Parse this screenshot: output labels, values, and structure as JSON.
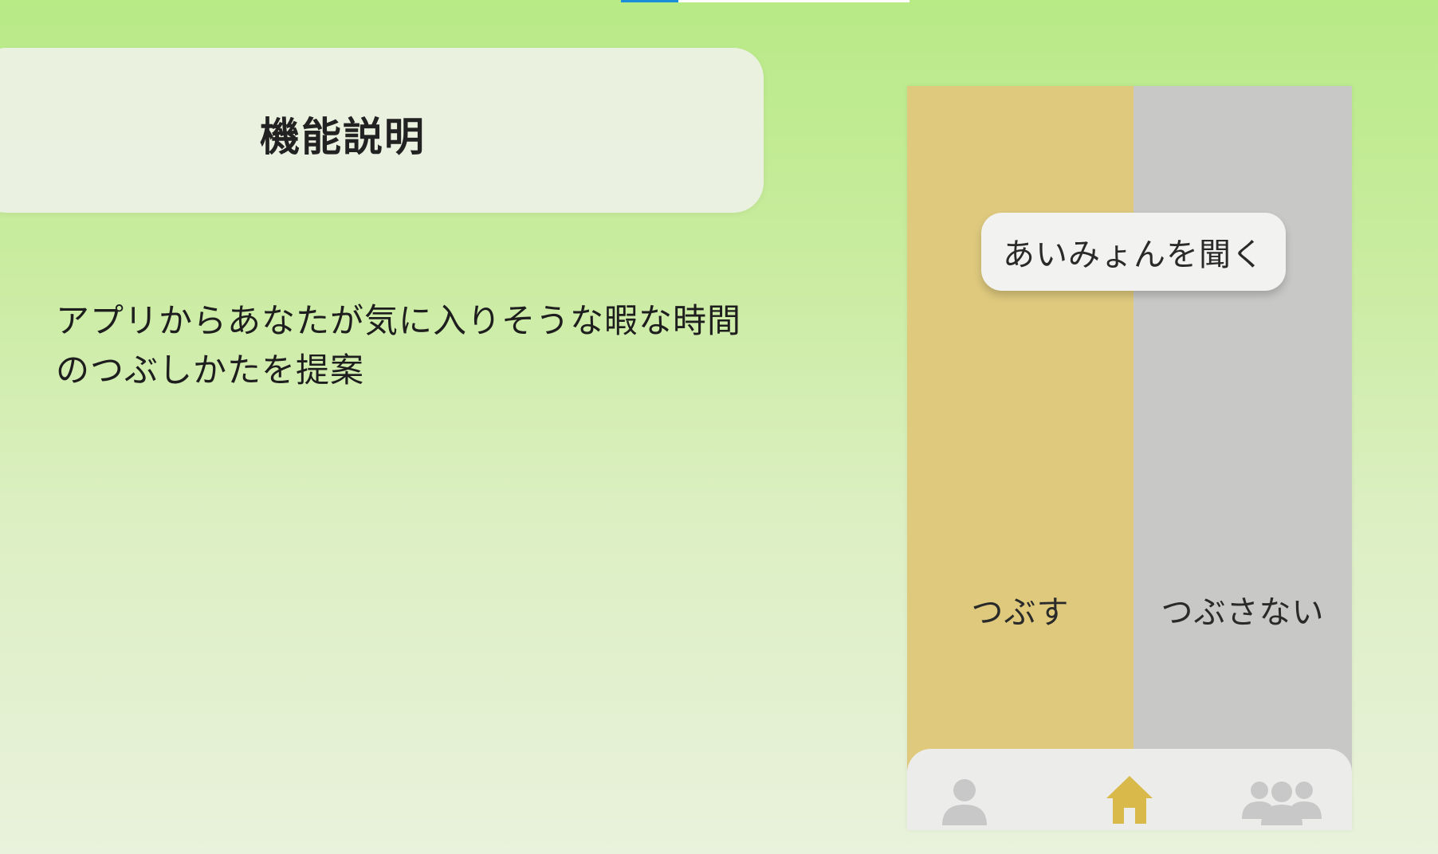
{
  "progress": {
    "fraction": 0.2,
    "fill_color": "#1a8ed8"
  },
  "header": {
    "title": "機能説明"
  },
  "description": {
    "line1": "アプリからあなたが気に入りそうな暇な時間",
    "line2": "のつぶしかたを提案"
  },
  "phone": {
    "suggestion": "あいみょんを聞く",
    "choice_left": "つぶす",
    "choice_right": "つぶさない",
    "colors": {
      "left_panel": "#dec97d",
      "right_panel": "#c8c8c6",
      "nav_active": "#d9b94a",
      "nav_inactive": "#c8c8c8"
    },
    "nav": {
      "items": [
        {
          "icon": "person-icon",
          "active": false
        },
        {
          "icon": "home-icon",
          "active": true
        },
        {
          "icon": "group-icon",
          "active": false
        }
      ]
    }
  }
}
